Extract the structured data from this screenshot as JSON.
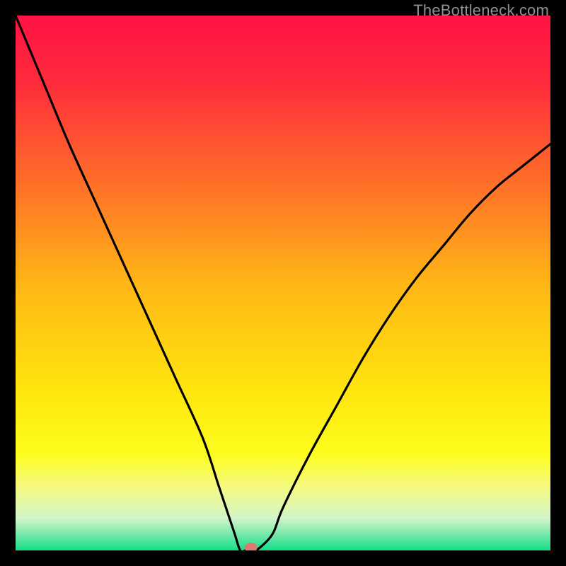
{
  "watermark": "TheBottleneck.com",
  "chart_data": {
    "type": "line",
    "title": "",
    "xlabel": "",
    "ylabel": "",
    "xlim": [
      0,
      100
    ],
    "ylim": [
      0,
      100
    ],
    "x": [
      0,
      5,
      10,
      15,
      20,
      25,
      30,
      35,
      38,
      40,
      41,
      42,
      43,
      44,
      45,
      48,
      50,
      55,
      60,
      65,
      70,
      75,
      80,
      85,
      90,
      95,
      100
    ],
    "values": [
      100,
      88,
      76,
      65,
      54,
      43,
      32,
      21,
      12,
      6,
      3,
      0,
      0,
      0,
      0,
      3,
      8,
      18,
      27,
      36,
      44,
      51,
      57,
      63,
      68,
      72,
      76
    ],
    "marker": {
      "x": 44,
      "y": 0
    },
    "grid": false,
    "legend": false,
    "gradient_stops": [
      {
        "pos": 0.0,
        "color": "#ff1245"
      },
      {
        "pos": 0.12,
        "color": "#ff2a3c"
      },
      {
        "pos": 0.3,
        "color": "#ff6a2a"
      },
      {
        "pos": 0.5,
        "color": "#ffb616"
      },
      {
        "pos": 0.7,
        "color": "#ffe50e"
      },
      {
        "pos": 0.82,
        "color": "#fdfd1e"
      },
      {
        "pos": 0.88,
        "color": "#f6fa80"
      },
      {
        "pos": 0.94,
        "color": "#d2f5c9"
      },
      {
        "pos": 0.975,
        "color": "#66e6a6"
      },
      {
        "pos": 1.0,
        "color": "#14df87"
      }
    ]
  }
}
